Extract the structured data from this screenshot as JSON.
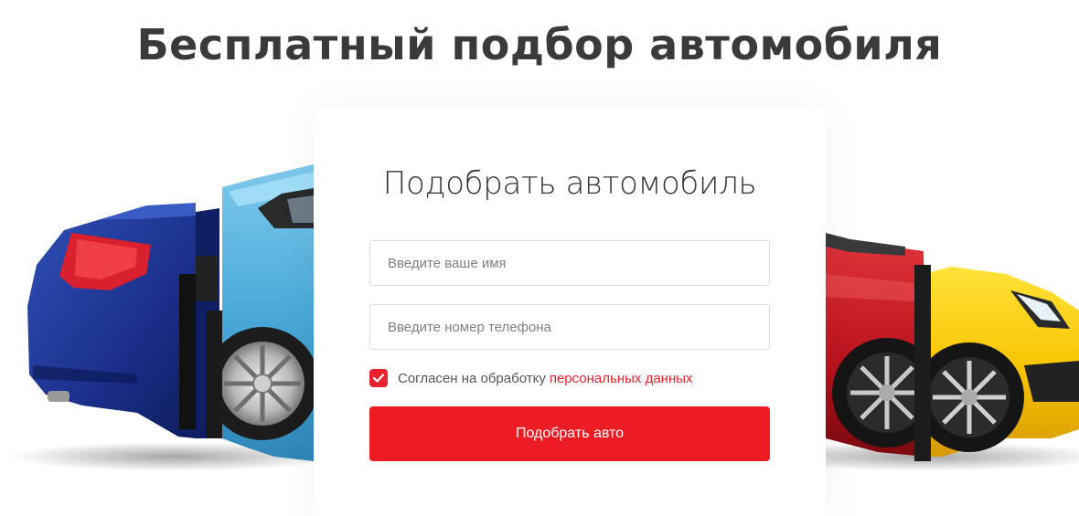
{
  "page": {
    "title": "Бесплатный подбор автомобиля"
  },
  "form": {
    "heading": "Подобрать автомобиль",
    "name_placeholder": "Введите ваше имя",
    "phone_placeholder": "Введите номер телефона",
    "consent_checked": true,
    "consent_text": "Согласен на обработку",
    "consent_link": "персональных данных",
    "submit_label": "Подобрать авто"
  },
  "decor": {
    "cars": [
      "blue-sedan",
      "light-blue-sedan",
      "red-car",
      "yellow-sports-car"
    ],
    "accent_color": "#ed1c24"
  }
}
